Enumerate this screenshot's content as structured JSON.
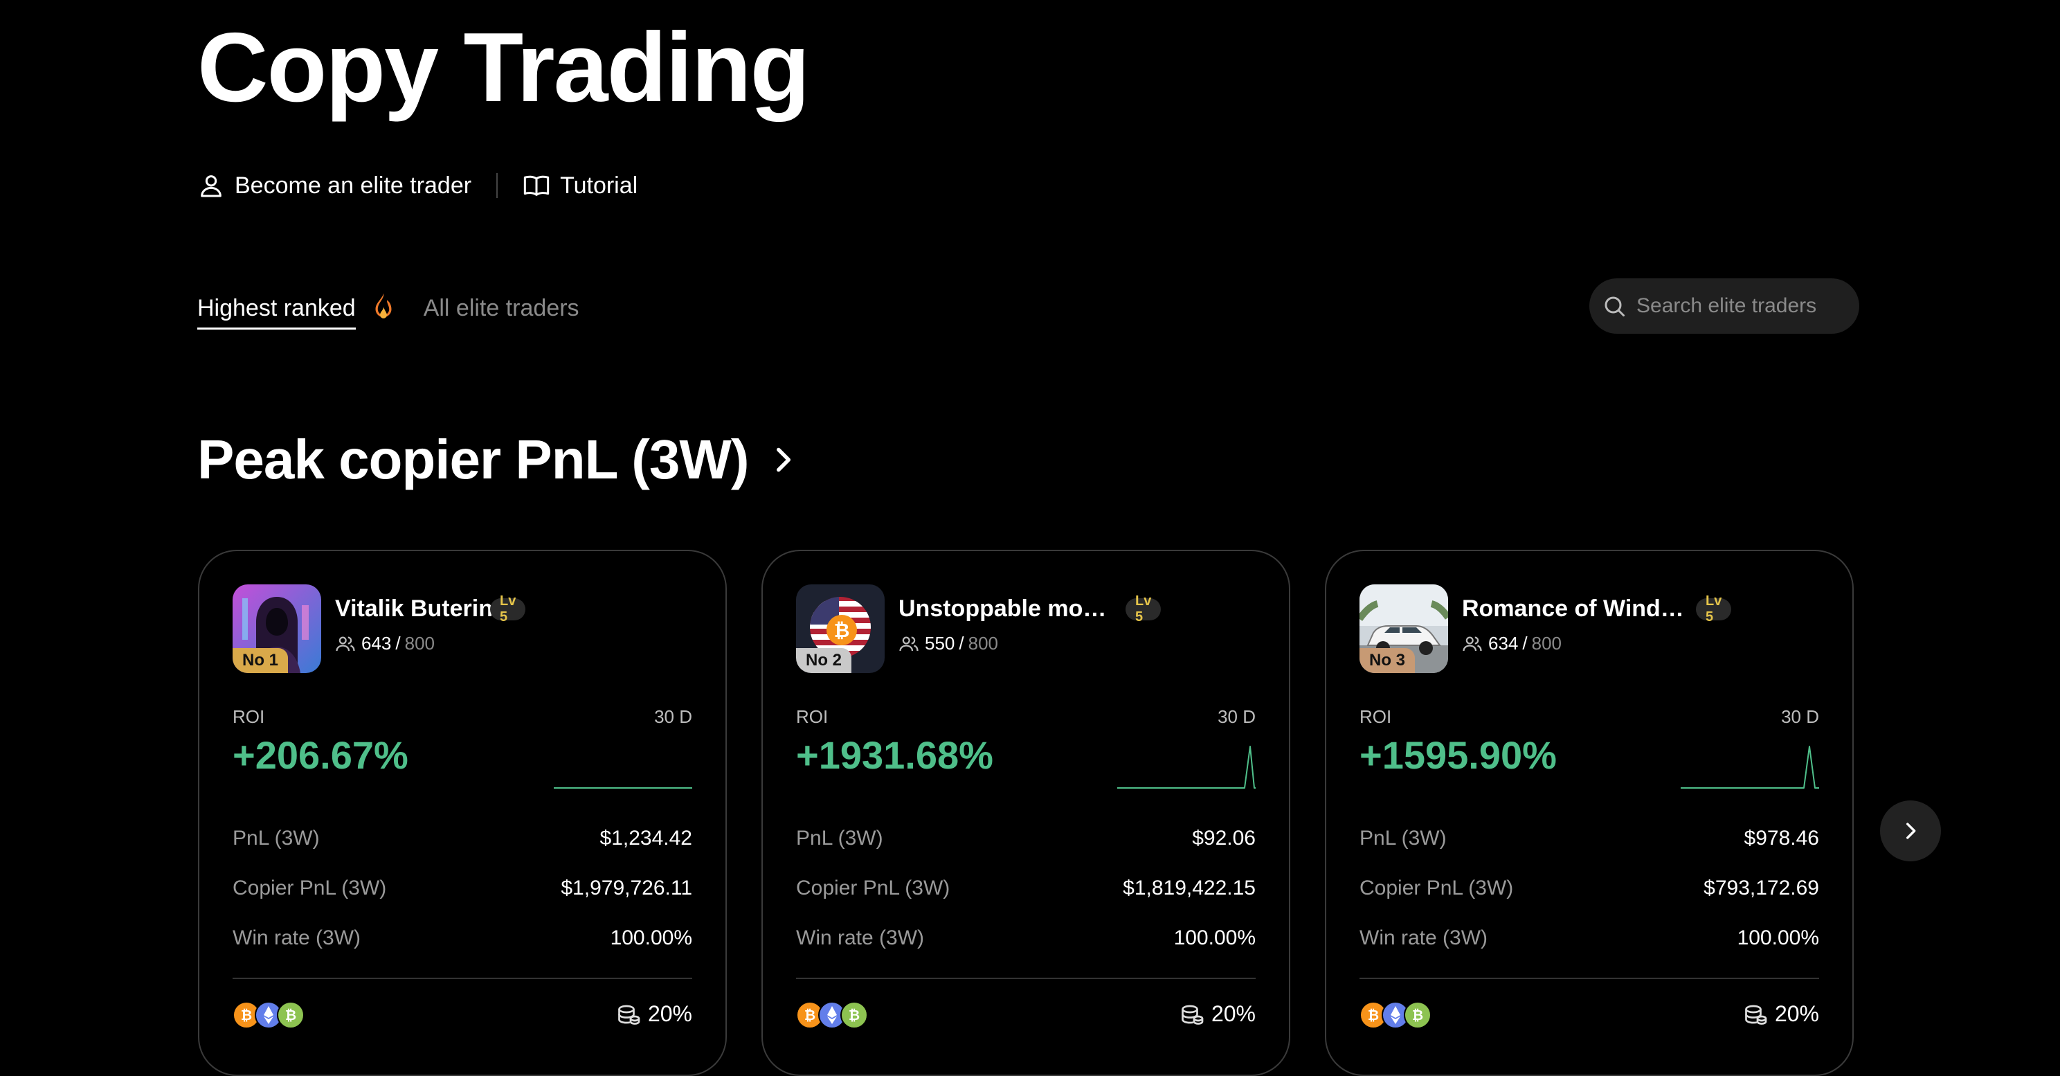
{
  "page": {
    "title": "Copy Trading"
  },
  "links": {
    "become_elite": "Become an elite trader",
    "tutorial": "Tutorial"
  },
  "tabs": {
    "highest_ranked": "Highest ranked",
    "all_elite": "All elite traders"
  },
  "search": {
    "placeholder": "Search elite traders"
  },
  "section": {
    "title": "Peak copier PnL (3W)"
  },
  "colors": {
    "positive": "#4fbf8a",
    "level_badge": "#e6c54a",
    "background": "#000000"
  },
  "cards": [
    {
      "rank": "No 1",
      "name": "Vitalik Buterin",
      "level": "Lv 5",
      "copiers": "643",
      "copiers_sep": "/",
      "copiers_max": "800",
      "roi_label": "ROI",
      "period": "30 D",
      "roi": "+206.67%",
      "pnl_label": "PnL (3W)",
      "pnl": "$1,234.42",
      "copier_pnl_label": "Copier PnL (3W)",
      "copier_pnl": "$1,979,726.11",
      "win_rate_label": "Win rate (3W)",
      "win_rate": "100.00%",
      "profit_share": "20%",
      "coins": [
        "bitcoin-icon",
        "ethereum-icon",
        "bitcoin-cash-icon"
      ]
    },
    {
      "rank": "No 2",
      "name": "Unstoppable mo…",
      "level": "Lv 5",
      "copiers": "550",
      "copiers_sep": "/",
      "copiers_max": "800",
      "roi_label": "ROI",
      "period": "30 D",
      "roi": "+1931.68%",
      "pnl_label": "PnL (3W)",
      "pnl": "$92.06",
      "copier_pnl_label": "Copier PnL (3W)",
      "copier_pnl": "$1,819,422.15",
      "win_rate_label": "Win rate (3W)",
      "win_rate": "100.00%",
      "profit_share": "20%",
      "coins": [
        "bitcoin-icon",
        "ethereum-icon",
        "bitcoin-cash-icon"
      ]
    },
    {
      "rank": "No 3",
      "name": "Romance of Wind…",
      "level": "Lv 5",
      "copiers": "634",
      "copiers_sep": "/",
      "copiers_max": "800",
      "roi_label": "ROI",
      "period": "30 D",
      "roi": "+1595.90%",
      "pnl_label": "PnL (3W)",
      "pnl": "$978.46",
      "copier_pnl_label": "Copier PnL (3W)",
      "copier_pnl": "$793,172.69",
      "win_rate_label": "Win rate (3W)",
      "win_rate": "100.00%",
      "profit_share": "20%",
      "coins": [
        "bitcoin-icon",
        "ethereum-icon",
        "bitcoin-cash-icon"
      ]
    }
  ]
}
